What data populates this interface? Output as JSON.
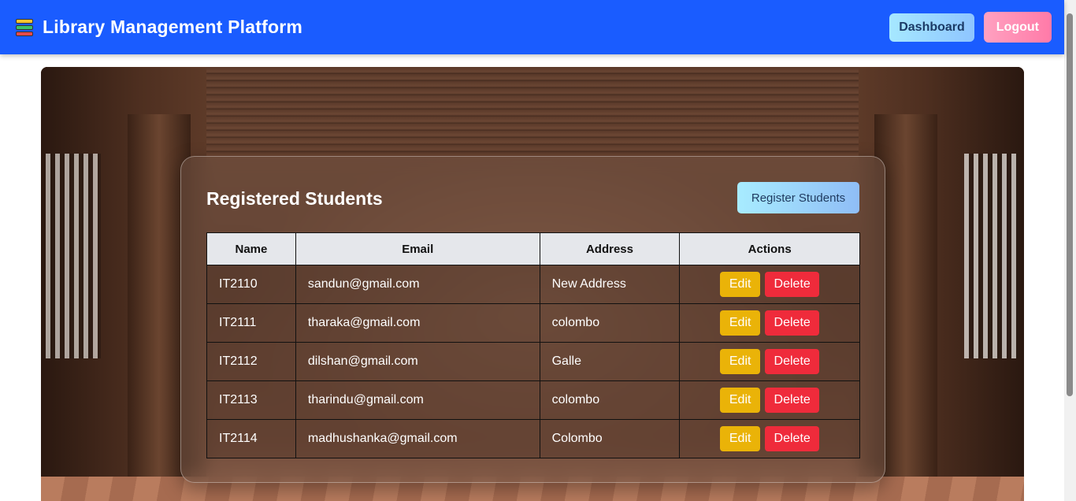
{
  "navbar": {
    "brand_icon": "books-icon",
    "title": "Library Management Platform",
    "dashboard_label": "Dashboard",
    "logout_label": "Logout"
  },
  "card": {
    "title": "Registered Students",
    "register_label": "Register Students"
  },
  "table": {
    "headers": [
      "Name",
      "Email",
      "Address",
      "Actions"
    ],
    "rows": [
      {
        "name": "IT2110",
        "email": "sandun@gmail.com",
        "address": "New Address"
      },
      {
        "name": "IT2111",
        "email": "tharaka@gmail.com",
        "address": "colombo"
      },
      {
        "name": "IT2112",
        "email": "dilshan@gmail.com",
        "address": "Galle"
      },
      {
        "name": "IT2113",
        "email": "tharindu@gmail.com",
        "address": "colombo"
      },
      {
        "name": "IT2114",
        "email": "madhushanka@gmail.com",
        "address": "Colombo"
      }
    ],
    "edit_label": "Edit",
    "delete_label": "Delete"
  },
  "colors": {
    "navbar": "#1a5cff",
    "edit": "#eab308",
    "delete": "#ef2b3b",
    "header_row": "#e5e7eb"
  }
}
